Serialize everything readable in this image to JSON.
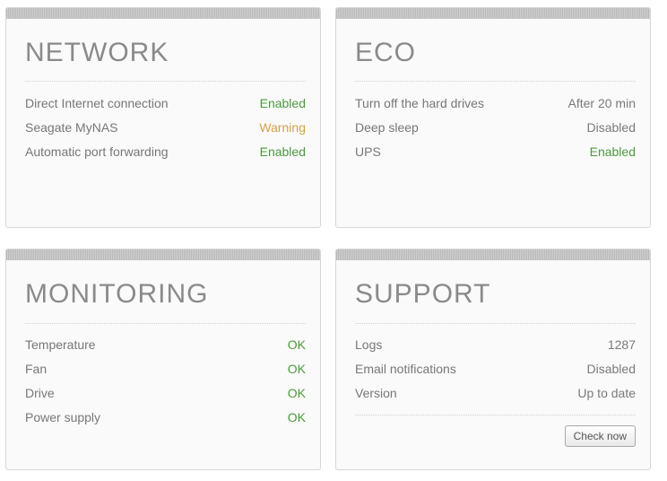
{
  "network": {
    "title": "NETWORK",
    "rows": [
      {
        "label": "Direct Internet connection",
        "value": "Enabled"
      },
      {
        "label": "Seagate MyNAS",
        "value": "Warning"
      },
      {
        "label": "Automatic port forwarding",
        "value": "Enabled"
      }
    ]
  },
  "eco": {
    "title": "ECO",
    "rows": [
      {
        "label": "Turn off the hard drives",
        "value": "After 20 min"
      },
      {
        "label": "Deep sleep",
        "value": "Disabled"
      },
      {
        "label": "UPS",
        "value": "Enabled"
      }
    ]
  },
  "monitoring": {
    "title": "MONITORING",
    "rows": [
      {
        "label": "Temperature",
        "value": "OK"
      },
      {
        "label": "Fan",
        "value": "OK"
      },
      {
        "label": "Drive",
        "value": "OK"
      },
      {
        "label": "Power supply",
        "value": "OK"
      }
    ]
  },
  "support": {
    "title": "SUPPORT",
    "rows": [
      {
        "label": "Logs",
        "value": "1287"
      },
      {
        "label": "Email notifications",
        "value": "Disabled"
      },
      {
        "label": "Version",
        "value": "Up to date"
      }
    ],
    "check_button_label": "Check now"
  },
  "colors": {
    "enabled": "#4a9a3c",
    "ok": "#4a9a3c",
    "warning": "#d4a04a",
    "neutral": "#7a7a7a",
    "title": "#8a8a8a"
  }
}
